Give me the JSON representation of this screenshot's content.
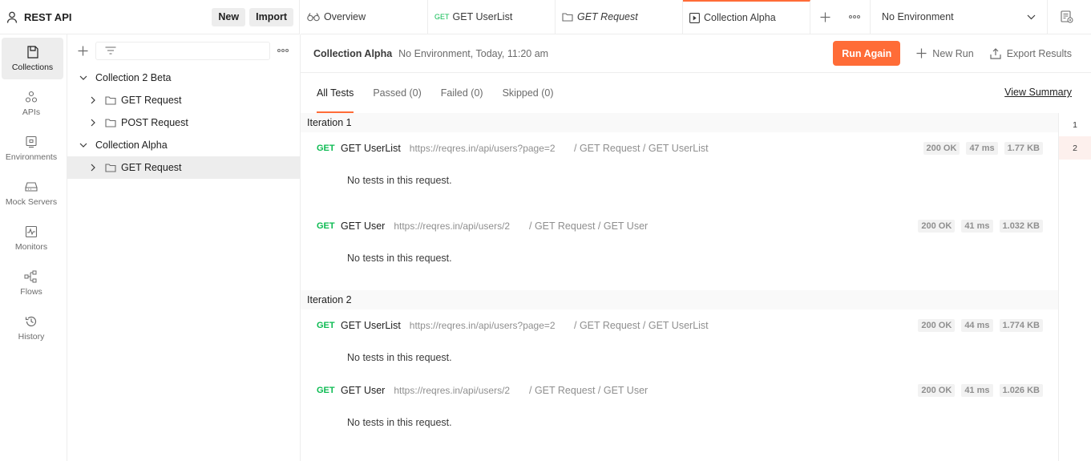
{
  "workspace": {
    "name": "REST API",
    "new_label": "New",
    "import_label": "Import"
  },
  "tabs": [
    {
      "label": "Overview",
      "method": "",
      "italic": false,
      "active": false,
      "icon": "overview-icon"
    },
    {
      "label": "GET UserList",
      "method": "GET",
      "italic": false,
      "active": false,
      "icon": ""
    },
    {
      "label": "GET Request",
      "method": "",
      "italic": true,
      "active": false,
      "icon": "folder-icon"
    },
    {
      "label": "Collection Alpha",
      "method": "",
      "italic": false,
      "active": true,
      "icon": "runner-icon"
    }
  ],
  "environment": {
    "selected": "No Environment"
  },
  "rail": [
    {
      "label": "Collections",
      "icon": "collections-icon",
      "active": true
    },
    {
      "label": "APIs",
      "icon": "apis-icon",
      "active": false
    },
    {
      "label": "Environments",
      "icon": "environments-icon",
      "active": false
    },
    {
      "label": "Mock Servers",
      "icon": "mock-servers-icon",
      "active": false
    },
    {
      "label": "Monitors",
      "icon": "monitors-icon",
      "active": false
    },
    {
      "label": "Flows",
      "icon": "flows-icon",
      "active": false
    },
    {
      "label": "History",
      "icon": "history-icon",
      "active": false
    }
  ],
  "tree": {
    "items": [
      {
        "label": "Collection 2 Beta",
        "level": 0,
        "expanded": true,
        "folder": false
      },
      {
        "label": "GET Request",
        "level": 1,
        "expanded": false,
        "folder": true
      },
      {
        "label": "POST Request",
        "level": 1,
        "expanded": false,
        "folder": true
      },
      {
        "label": "Collection Alpha",
        "level": 0,
        "expanded": true,
        "folder": false
      },
      {
        "label": "GET Request",
        "level": 1,
        "expanded": false,
        "folder": true,
        "selected": true
      }
    ]
  },
  "run": {
    "title": "Collection Alpha",
    "subtitle": "No Environment, Today, 11:20 am",
    "run_again_label": "Run Again",
    "new_run_label": "New Run",
    "export_label": "Export Results"
  },
  "filter_tabs": [
    {
      "label": "All Tests",
      "active": true
    },
    {
      "label": "Passed (0)",
      "active": false
    },
    {
      "label": "Failed (0)",
      "active": false
    },
    {
      "label": "Skipped (0)",
      "active": false
    }
  ],
  "view_summary_label": "View Summary",
  "iterations": [
    {
      "label": "Iteration 1",
      "requests": [
        {
          "method": "GET",
          "name": "GET UserList",
          "url": "https://reqres.in/api/users?page=2",
          "path": "/ GET Request / GET UserList",
          "status": "200 OK",
          "time": "47 ms",
          "size": "1.77 KB",
          "note": "No tests in this request."
        },
        {
          "method": "GET",
          "name": "GET User",
          "url": "https://reqres.in/api/users/2",
          "path": "/ GET Request / GET User",
          "status": "200 OK",
          "time": "41 ms",
          "size": "1.032 KB",
          "note": "No tests in this request."
        }
      ]
    },
    {
      "label": "Iteration 2",
      "requests": [
        {
          "method": "GET",
          "name": "GET UserList",
          "url": "https://reqres.in/api/users?page=2",
          "path": "/ GET Request / GET UserList",
          "status": "200 OK",
          "time": "44 ms",
          "size": "1.774 KB",
          "note": "No tests in this request."
        },
        {
          "method": "GET",
          "name": "GET User",
          "url": "https://reqres.in/api/users/2",
          "path": "/ GET Request / GET User",
          "status": "200 OK",
          "time": "41 ms",
          "size": "1.026 KB",
          "note": "No tests in this request."
        }
      ]
    }
  ],
  "iteration_rail": [
    "1",
    "2"
  ],
  "colors": {
    "accent": "#ff6c37",
    "get": "#0cbb52"
  }
}
